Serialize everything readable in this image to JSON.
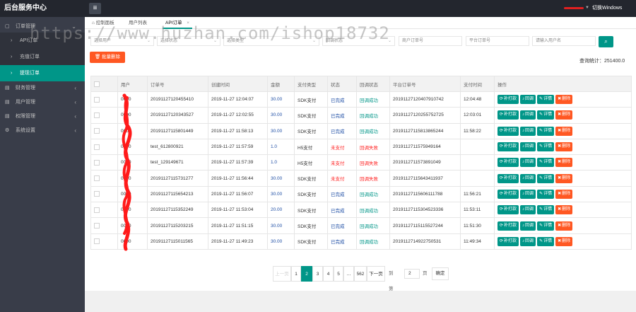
{
  "header": {
    "logo": "后台服务中心",
    "menu_icon": "hamburger-icon",
    "switch_label": "切换Windows"
  },
  "sidebar": {
    "groups": [
      {
        "label": "订单管理",
        "expanded": true,
        "children": [
          {
            "label": "API订单",
            "active": false
          },
          {
            "label": "充值订单",
            "active": false
          },
          {
            "label": "提现订单",
            "active": true
          }
        ]
      },
      {
        "label": "财务管理",
        "expanded": false
      },
      {
        "label": "用户管理",
        "expanded": false
      },
      {
        "label": "权限管理",
        "expanded": false
      },
      {
        "label": "系统设置",
        "expanded": false
      }
    ]
  },
  "tabs": [
    {
      "label": "控制面板",
      "icon": "home-icon"
    },
    {
      "label": "用户列表"
    },
    {
      "label": "API订单",
      "active": true,
      "close": "×"
    }
  ],
  "filters": {
    "f1": "选择用户",
    "f2": "选择状态",
    "f3": "选择类型",
    "f4": "回调状态",
    "f5_placeholder": "商户订单号",
    "f6_placeholder": "平台订单号",
    "f7_placeholder": "请输入用户名"
  },
  "toolbar": {
    "batch_delete": "批量删除",
    "stats": "查询统计：251400.0"
  },
  "table": {
    "headers": [
      "",
      "用户",
      "订单号",
      "创建时间",
      "金额",
      "支付类型",
      "状态",
      "回调状态",
      "平台订单号",
      "支付时间",
      "操作"
    ],
    "actions": {
      "resend": "补打款",
      "callback": "回调",
      "detail": "详情",
      "delete": "删除"
    },
    "rows": [
      {
        "user": "0000",
        "order": "20191127120455410",
        "created": "2019-11-27 12:04:07",
        "amount": "30.00",
        "ptype": "SDK支付",
        "status": "已完成",
        "status_ok": true,
        "callback": "回调成功",
        "callback_ok": true,
        "platform_order": "2019112712040791074​2",
        "paid": "12:04:48"
      },
      {
        "user": "0000",
        "order": "20191127120343527",
        "created": "2019-11-27 12:02:55",
        "amount": "30.00",
        "ptype": "SDK支付",
        "status": "已完成",
        "status_ok": true,
        "callback": "回调成功",
        "callback_ok": true,
        "platform_order": "2019112712025575272​5",
        "paid": "12:03:01"
      },
      {
        "user": "0000",
        "order": "20191127115801449",
        "created": "2019-11-27 11:58:13",
        "amount": "30.00",
        "ptype": "SDK支付",
        "status": "已完成",
        "status_ok": true,
        "callback": "回调成功",
        "callback_ok": true,
        "platform_order": "2019112711581386524​4",
        "paid": "11:58:22"
      },
      {
        "user": "0000",
        "order": "test_612800921",
        "created": "2019-11-27 11:57:59",
        "amount": "1.0",
        "ptype": "H5支付",
        "status": "未支付",
        "status_ok": false,
        "callback": "回调失败",
        "callback_ok": false,
        "platform_order": "2019112711575949164",
        "paid": ""
      },
      {
        "user": "0000",
        "order": "test_129149671",
        "created": "2019-11-27 11:57:39",
        "amount": "1.0",
        "ptype": "H5支付",
        "status": "未支付",
        "status_ok": false,
        "callback": "回调失败",
        "callback_ok": false,
        "platform_order": "2019112711573891049",
        "paid": ""
      },
      {
        "user": "0000",
        "order": "20191127115731277",
        "created": "2019-11-27 11:56:44",
        "amount": "30.00",
        "ptype": "SDK支付",
        "status": "未支付",
        "status_ok": false,
        "callback": "回调失败",
        "callback_ok": false,
        "platform_order": "20191127115643411937",
        "paid": ""
      },
      {
        "user": "0000",
        "order": "20191127115654213",
        "created": "2019-11-27 11:56:07",
        "amount": "30.00",
        "ptype": "SDK支付",
        "status": "已完成",
        "status_ok": true,
        "callback": "回调成功",
        "callback_ok": true,
        "platform_order": "2019112711560611178​8",
        "paid": "11:56:21"
      },
      {
        "user": "0000",
        "order": "20191127115352249",
        "created": "2019-11-27 11:53:04",
        "amount": "20.00",
        "ptype": "SDK支付",
        "status": "已完成",
        "status_ok": true,
        "callback": "回调成功",
        "callback_ok": true,
        "platform_order": "2019112711530452333​6",
        "paid": "11:53:11"
      },
      {
        "user": "0000",
        "order": "20191127115203215",
        "created": "2019-11-27 11:51:15",
        "amount": "30.00",
        "ptype": "SDK支付",
        "status": "已完成",
        "status_ok": true,
        "callback": "回调成功",
        "callback_ok": true,
        "platform_order": "2019112711511552724​4",
        "paid": "11:51:30"
      },
      {
        "user": "0000",
        "order": "20191127115011565",
        "created": "2019-11-27 11:49:23",
        "amount": "30.00",
        "ptype": "SDK支付",
        "status": "已完成",
        "status_ok": true,
        "callback": "回调成功",
        "callback_ok": true,
        "platform_order": "2019112714922750531",
        "paid": "11:49:34"
      }
    ]
  },
  "pager": {
    "prev": "上一页",
    "pages": [
      "1",
      "2",
      "3",
      "4",
      "5",
      "…",
      "562"
    ],
    "current": "2",
    "next": "下一页",
    "goto_label": "到第",
    "goto_value": "2",
    "page_unit": "页",
    "confirm": "确定"
  },
  "watermark": "https://www.huzhan.com/ishop18732",
  "colors": {
    "sidebar": "#393d49",
    "topbar": "#23262e",
    "accent": "#009688",
    "danger": "#ff5722"
  }
}
